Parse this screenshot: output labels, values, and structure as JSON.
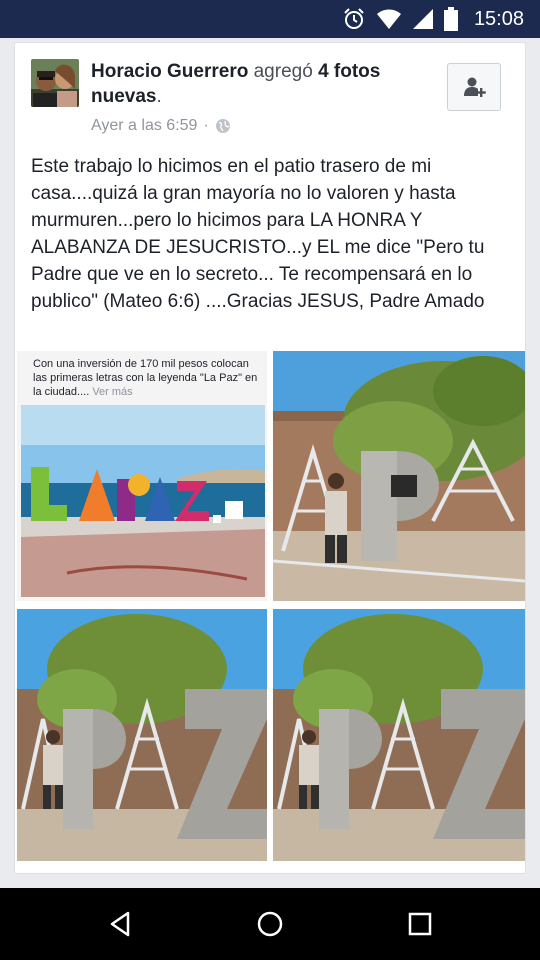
{
  "status_bar": {
    "time": "15:08",
    "icons": [
      "alarm-icon",
      "wifi-icon",
      "signal-icon",
      "battery-icon"
    ]
  },
  "post": {
    "author": "Horacio Guerrero",
    "action_prefix": " agregó ",
    "action_bold": "4 fotos nuevas",
    "action_suffix": ".",
    "timestamp": "Ayer a las 6:59",
    "separator": "·",
    "privacy_icon": "globe-icon",
    "text": "Este trabajo lo hicimos en el patio trasero de mi casa....quizá la gran mayoría no lo valoren y hasta murmuren...pero lo hicimos para LA HONRA Y ALABANZA DE JESUCRISTO...y EL me dice \"Pero tu Padre que ve en lo secreto... Te recompensará en lo publico\" (Mateo 6:6) ....Gracias JESUS, Padre Amado",
    "photo_caption": "Con una inversión de 170 mil pesos colocan las primeras letras con la leyenda \"La Paz\" en la ciudad....",
    "photo_caption_more": "Ver más",
    "sign_letters": [
      "L",
      "A",
      "P",
      "A",
      "Z"
    ]
  },
  "colors": {
    "status_bar": "#1d2a4f",
    "nav_bar": "#000000",
    "text": "#1d2129",
    "meta": "#90949c"
  },
  "nav": {
    "back": "back-icon",
    "home": "home-icon",
    "recents": "recents-icon"
  }
}
